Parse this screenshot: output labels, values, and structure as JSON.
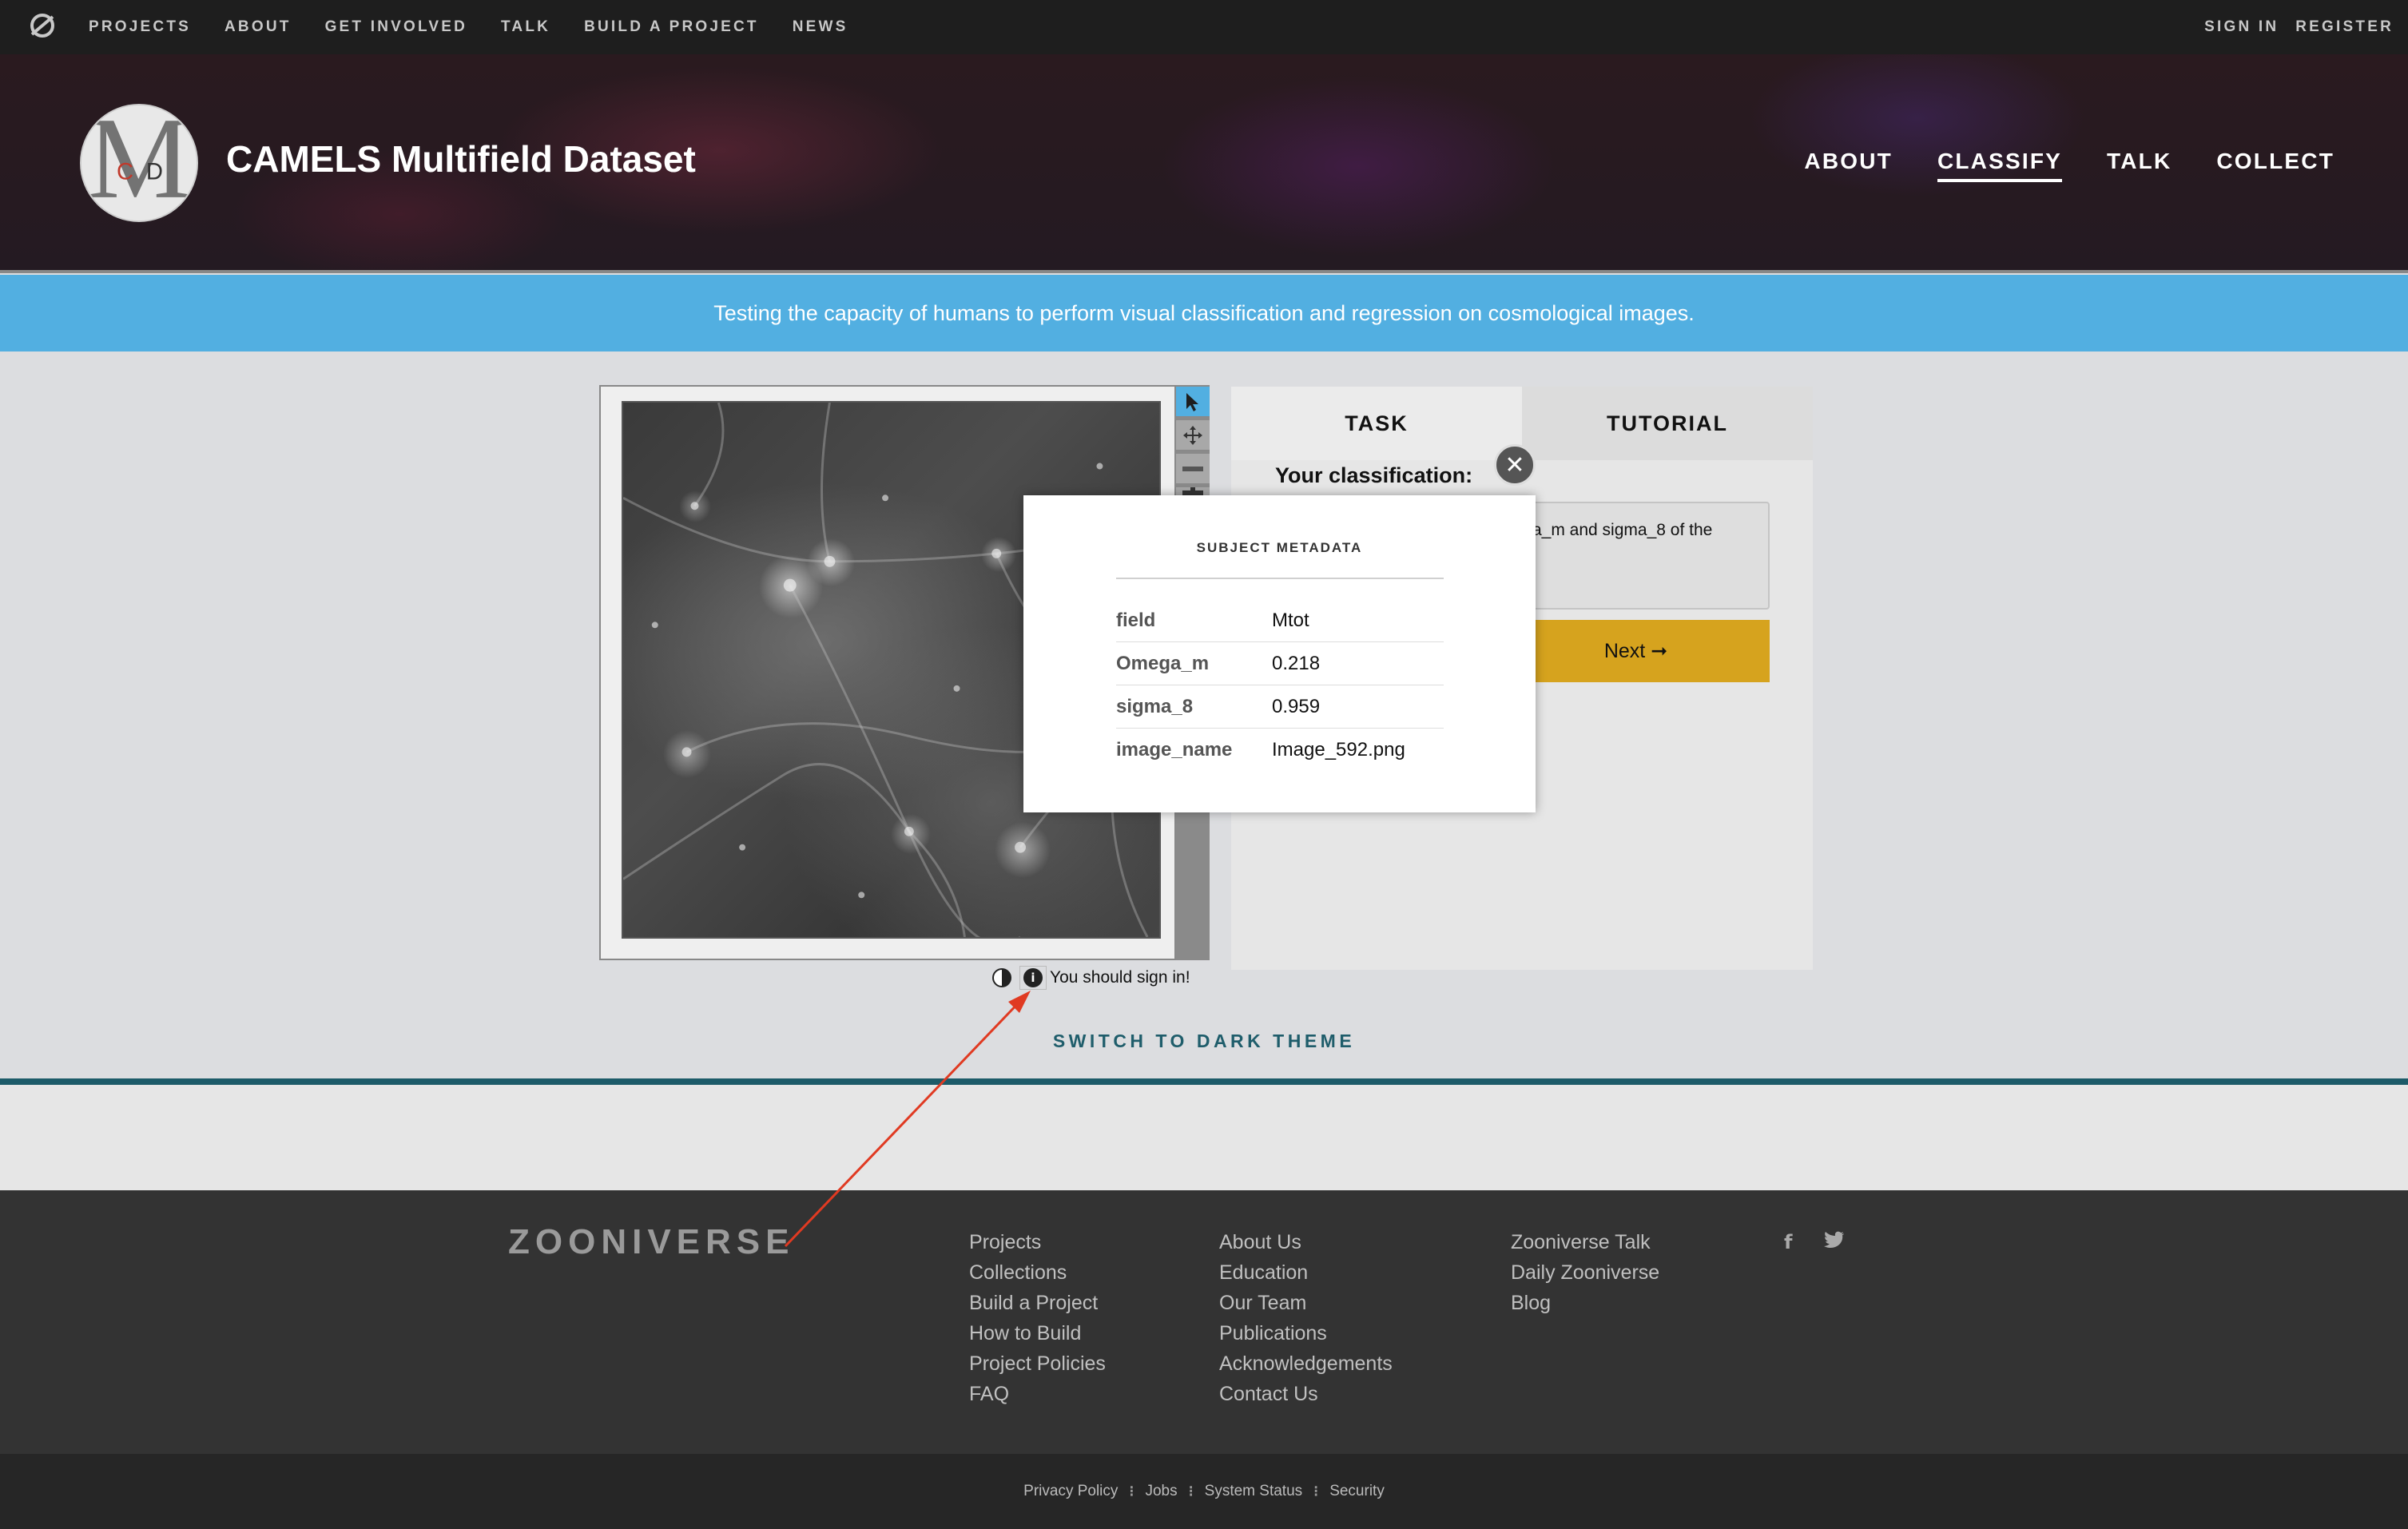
{
  "topnav": {
    "links": [
      "PROJECTS",
      "ABOUT",
      "GET INVOLVED",
      "TALK",
      "BUILD A PROJECT",
      "NEWS"
    ],
    "sign_in": "SIGN IN",
    "register": "REGISTER"
  },
  "project": {
    "title": "CAMELS Multifield Dataset",
    "nav": [
      "ABOUT",
      "CLASSIFY",
      "TALK",
      "COLLECT"
    ],
    "active_nav": "CLASSIFY"
  },
  "announcement": "Testing the capacity of humans to perform visual classification and regression on cosmological images.",
  "viewer": {
    "signin_message": "You should sign in!"
  },
  "task_panel": {
    "tabs": [
      "TASK",
      "TUTORIAL"
    ],
    "your_classification": "Your classification:",
    "question_visible": "a_m and sigma_8 of the",
    "next_label": "Next ➞"
  },
  "metadata_modal": {
    "title": "SUBJECT METADATA",
    "rows": [
      {
        "key": "field",
        "value": "Mtot"
      },
      {
        "key": "Omega_m",
        "value": "0.218"
      },
      {
        "key": "sigma_8",
        "value": "0.959"
      },
      {
        "key": "image_name",
        "value": "Image_592.png"
      }
    ]
  },
  "theme_toggle": "SWITCH TO DARK THEME",
  "footer": {
    "logo": "ZOONIVERSE",
    "col1": [
      "Projects",
      "Collections",
      "Build a Project",
      "How to Build",
      "Project Policies",
      "FAQ"
    ],
    "col2": [
      "About Us",
      "Education",
      "Our Team",
      "Publications",
      "Acknowledgements",
      "Contact Us"
    ],
    "col3": [
      "Zooniverse Talk",
      "Daily Zooniverse",
      "Blog"
    ],
    "legal": [
      "Privacy Policy",
      "Jobs",
      "System Status",
      "Security"
    ]
  },
  "colors": {
    "announcement_bg": "#52afe1",
    "next_button": "#d6a31e",
    "teal_accent": "#1d5b69",
    "annotation_arrow": "#e03a22"
  }
}
